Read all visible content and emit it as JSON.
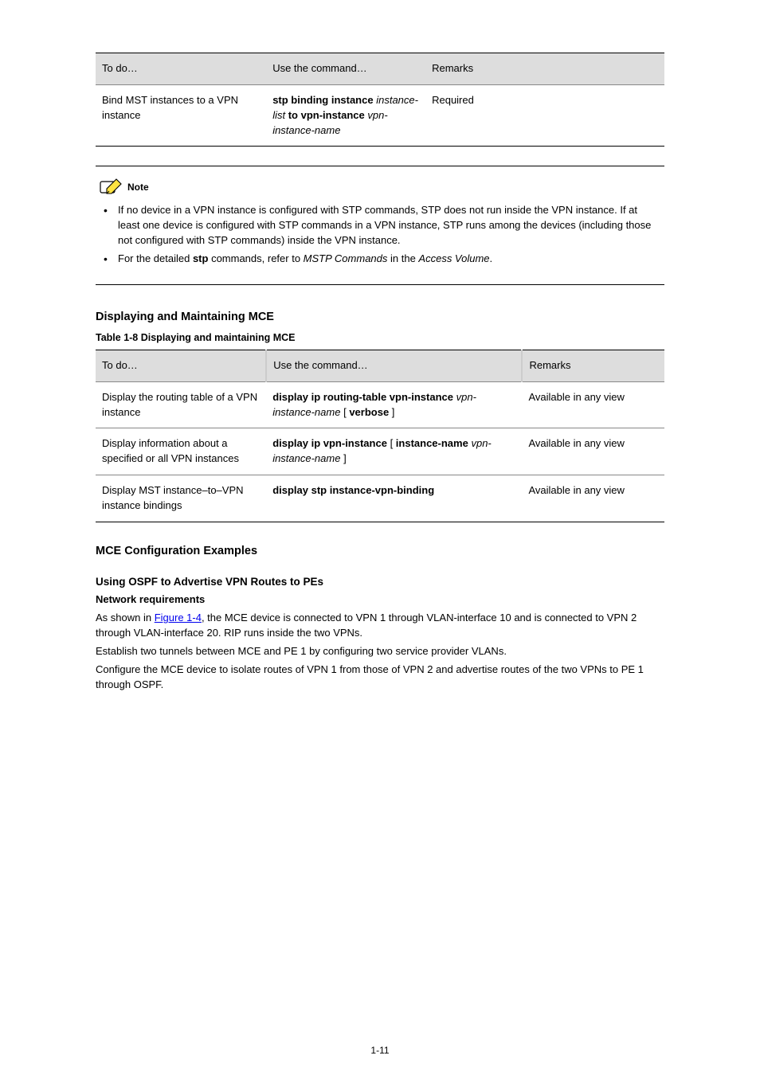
{
  "table1": {
    "headers": [
      "To do…",
      "Use the command…",
      "Remarks"
    ],
    "row": {
      "todo": "Bind MST instances to a VPN instance",
      "cmd": "stp binding instance instance-list to vpn-instance vpn-instance-name",
      "remarks": "Required"
    }
  },
  "note": {
    "label": "Note",
    "bullets": [
      "If no device in a VPN instance is configured with STP commands, STP does not run inside the VPN instance. If at least one device is configured with STP commands in a VPN instance, STP runs among the devices (including those not configured with STP commands) inside the VPN instance.",
      "For the detailed stp commands, refer to MSTP Commands in the Access Volume."
    ]
  },
  "display": {
    "heading": "Displaying and Maintaining MCE",
    "caption": "Table 1-8 Displaying and maintaining MCE",
    "headers": [
      "To do…",
      "Use the command…",
      "Remarks"
    ],
    "rows": [
      {
        "todo": "Display the routing table of a VPN instance",
        "cmd": "display ip routing-table vpn-instance vpn-instance-name [ verbose ]",
        "remarks": "Available in any view"
      },
      {
        "todo": "Display information about a specified or all VPN instances",
        "cmd": "display ip vpn-instance [ instance-name vpn-instance-name ]",
        "remarks": "Available in any view"
      },
      {
        "todo": "Display MST instance–to–VPN instance bindings",
        "cmd": "display stp instance-vpn-binding",
        "remarks": "Available in any view"
      }
    ]
  },
  "examples": {
    "heading": "MCE Configuration Examples",
    "subheading": "Using OSPF to Advertise VPN Routes to PEs",
    "req_heading": "Network requirements",
    "req_para_1_prefix": "As shown in ",
    "req_link": "Figure 1-4",
    "req_para_1_suffix": ", the MCE device is connected to VPN 1 through VLAN-interface 10 and is connected to VPN 2 through VLAN-interface 20. RIP runs inside the two VPNs.",
    "req_para_2": "Establish two tunnels between MCE and PE 1 by configuring two service provider VLANs.",
    "req_para_3": "Configure the MCE device to isolate routes of VPN 1 from those of VPN 2 and advertise routes of the two VPNs to PE 1 through OSPF."
  },
  "page_number": "1-11"
}
